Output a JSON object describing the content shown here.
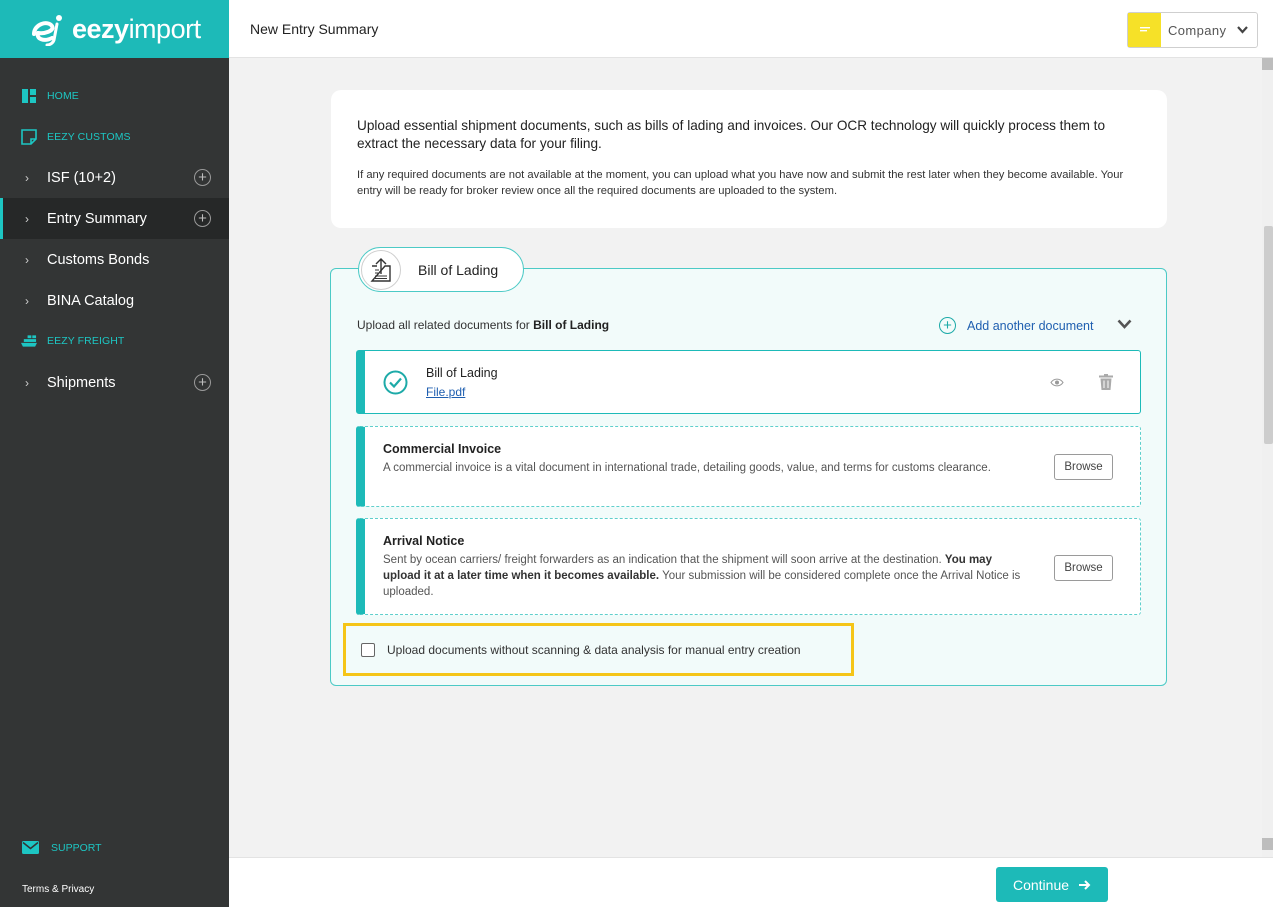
{
  "app": {
    "logo_bold": "eezy",
    "logo_light": "import"
  },
  "sidebar": {
    "home": "HOME",
    "eezy_customs": "EEZY CUSTOMS",
    "items_customs": [
      {
        "label": "ISF (10+2)",
        "has_add": true
      },
      {
        "label": "Entry Summary",
        "has_add": true,
        "active": true
      },
      {
        "label": "Customs Bonds",
        "has_add": false
      },
      {
        "label": "BINA Catalog",
        "has_add": false
      }
    ],
    "eezy_freight": "EEZY FREIGHT",
    "items_freight": [
      {
        "label": "Shipments",
        "has_add": true
      }
    ],
    "support": "SUPPORT",
    "terms": "Terms & Privacy"
  },
  "header": {
    "title": "New Entry Summary",
    "company_label": "Company"
  },
  "intro": {
    "paragraph1": "Upload essential shipment documents, such as bills of lading and invoices. Our OCR technology will quickly process them to extract the necessary data for your filing.",
    "paragraph2": "If any required documents are not available at the moment, you can upload what you have now and submit the rest later when they become available. Your entry will be ready for broker review once all the required documents are uploaded to the system."
  },
  "documents": {
    "tab_label": "Bill of Lading",
    "upload_prefix": "Upload all related documents for ",
    "upload_target": "Bill of Lading",
    "add_another": "Add another document",
    "uploaded": {
      "title": "Bill of Lading",
      "file": "File.pdf"
    },
    "commercial_invoice": {
      "title": "Commercial Invoice",
      "description": "A commercial invoice is a vital document in international trade, detailing goods, value, and terms for customs clearance.",
      "browse": "Browse"
    },
    "arrival_notice": {
      "title": "Arrival Notice",
      "desc_1": "Sent by ocean carriers/ freight forwarders as an indication that the shipment will soon arrive at the destination. ",
      "desc_bold": "You may upload it at a later time when it becomes available.",
      "desc_2": " Your submission will be considered complete once the Arrival Notice is uploaded.",
      "browse": "Browse"
    },
    "manual_checkbox": "Upload documents without scanning & data analysis for manual entry creation"
  },
  "footer": {
    "continue": "Continue"
  },
  "colors": {
    "brand": "#1dbab8",
    "sidebar": "#333535",
    "highlight": "#f5c518",
    "link": "#1f5fb0"
  }
}
